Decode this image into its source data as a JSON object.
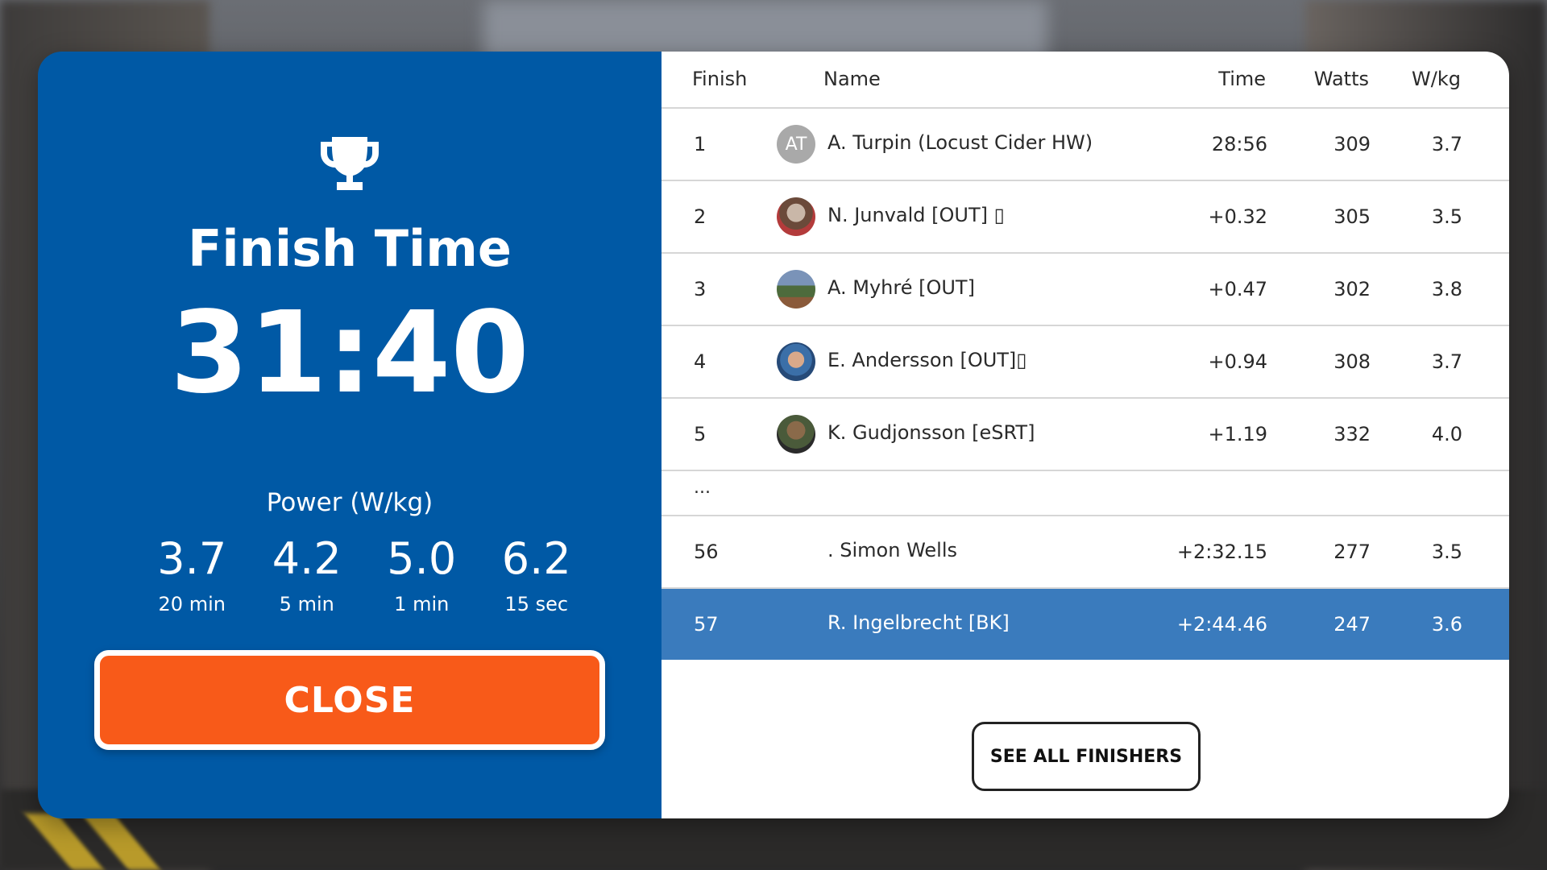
{
  "summary": {
    "title": "Finish Time",
    "time": "31:40",
    "power_label": "Power (W/kg)",
    "stats": [
      {
        "value": "3.7",
        "unit": "20 min"
      },
      {
        "value": "4.2",
        "unit": "5 min"
      },
      {
        "value": "5.0",
        "unit": "1 min"
      },
      {
        "value": "6.2",
        "unit": "15 sec"
      }
    ],
    "close_label": "CLOSE"
  },
  "table": {
    "headers": {
      "finish": "Finish",
      "name": "Name",
      "time": "Time",
      "watts": "Watts",
      "wkg": "W/kg"
    },
    "rows": [
      {
        "pos": "1",
        "avatar": "AT",
        "name": "A. Turpin (Locust Cider HW)",
        "time": "28:56",
        "watts": "309",
        "wkg": "3.7"
      },
      {
        "pos": "2",
        "avatar": "",
        "name": "N. Junvald  [OUT] ▯",
        "time": "+0.32",
        "watts": "305",
        "wkg": "3.5"
      },
      {
        "pos": "3",
        "avatar": "",
        "name": "A. Myhré [OUT]",
        "time": "+0.47",
        "watts": "302",
        "wkg": "3.8"
      },
      {
        "pos": "4",
        "avatar": "",
        "name": "E. Andersson [OUT]▯",
        "time": "+0.94",
        "watts": "308",
        "wkg": "3.7"
      },
      {
        "pos": "5",
        "avatar": "",
        "name": "K. Gudjonsson [eSRT]",
        "time": "+1.19",
        "watts": "332",
        "wkg": "4.0"
      }
    ],
    "ellipsis": "...",
    "rows_bottom": [
      {
        "pos": "56",
        "name": ". Simon Wells",
        "time": "+2:32.15",
        "watts": "277",
        "wkg": "3.5"
      },
      {
        "pos": "57",
        "name": "R. Ingelbrecht [BK]",
        "time": "+2:44.46",
        "watts": "247",
        "wkg": "3.6"
      }
    ],
    "see_all_label": "SEE ALL FINISHERS"
  },
  "colors": {
    "panel_blue": "#0059a5",
    "highlight_blue": "#3a7bbd",
    "close_orange": "#f85a19"
  },
  "icons": [
    "trophy-icon"
  ]
}
